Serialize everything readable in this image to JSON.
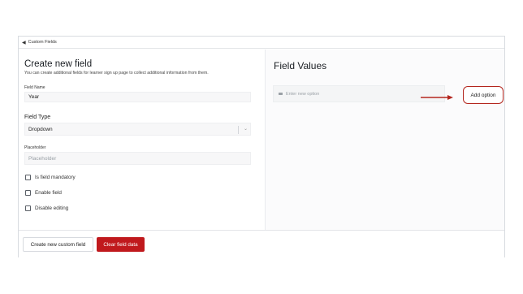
{
  "breadcrumb": {
    "label": "Custom Fields",
    "icon": "chevron-left-icon"
  },
  "form": {
    "title": "Create new field",
    "subtitle": "You can create additional fields for learner sign up page to collect additional information from them.",
    "field_name_label": "Field Name",
    "field_name_value": "Year",
    "field_type_label": "Field Type",
    "field_type_value": "Dropdown",
    "placeholder_label": "Placeholder",
    "placeholder_placeholder": "Placeholder",
    "checkboxes": [
      {
        "label": "Is field mandatory",
        "checked": false
      },
      {
        "label": "Enable field",
        "checked": false
      },
      {
        "label": "Disable editing",
        "checked": false
      }
    ]
  },
  "field_values": {
    "title": "Field Values",
    "option_placeholder": "Enter new option",
    "add_option_label": "Add option",
    "highlight_color": "#b3261e"
  },
  "footer": {
    "create_label": "Create new custom field",
    "clear_label": "Clear field data",
    "clear_color": "#c0191d"
  }
}
